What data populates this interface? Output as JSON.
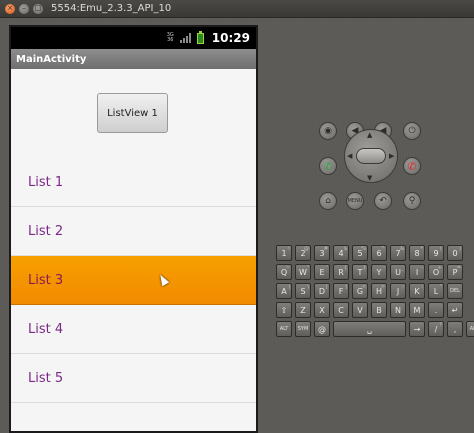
{
  "window": {
    "title": "5554:Emu_2.3.3_API_10"
  },
  "statusbar": {
    "net_top": "3G",
    "net_bottom": "36",
    "time": "10:29"
  },
  "app": {
    "title": "MainActivity",
    "button_label": "ListView 1",
    "list_items": [
      "List 1",
      "List 2",
      "List 3",
      "List 4",
      "List 5"
    ],
    "selected_index": 2
  },
  "controls": {
    "row1": [
      "camera-icon",
      "volume-down-icon",
      "volume-up-icon",
      "power-icon"
    ],
    "row2": [
      "call-icon",
      "dpad",
      "end-call-icon"
    ],
    "row3": [
      "home-icon",
      "MENU",
      "back-icon",
      "search-icon"
    ]
  },
  "keyboard": {
    "row1": [
      {
        "k": "1",
        "s": "!"
      },
      {
        "k": "2",
        "s": "@"
      },
      {
        "k": "3",
        "s": "#"
      },
      {
        "k": "4",
        "s": "$"
      },
      {
        "k": "5",
        "s": "%"
      },
      {
        "k": "6",
        "s": "^"
      },
      {
        "k": "7",
        "s": "&"
      },
      {
        "k": "8",
        "s": "*"
      },
      {
        "k": "9",
        "s": "("
      },
      {
        "k": "0",
        "s": ")"
      }
    ],
    "row2": [
      {
        "k": "Q",
        "s": "~"
      },
      {
        "k": "W",
        "s": "\""
      },
      {
        "k": "E",
        "s": "'"
      },
      {
        "k": "R",
        "s": "{"
      },
      {
        "k": "T",
        "s": "}"
      },
      {
        "k": "Y",
        "s": "-"
      },
      {
        "k": "U",
        "s": "_"
      },
      {
        "k": "I",
        "s": "-"
      },
      {
        "k": "O",
        "s": "+"
      },
      {
        "k": "P",
        "s": "="
      }
    ],
    "row3": [
      {
        "k": "A",
        "s": "|"
      },
      {
        "k": "S",
        "s": "\\"
      },
      {
        "k": "D",
        "s": "["
      },
      {
        "k": "F",
        "s": "]"
      },
      {
        "k": "G",
        "s": "<"
      },
      {
        "k": "H",
        "s": ">"
      },
      {
        "k": "J",
        "s": ";"
      },
      {
        "k": "K",
        "s": ":"
      },
      {
        "k": "L",
        "s": "\""
      },
      {
        "k": "DEL",
        "s": ""
      }
    ],
    "row4": [
      {
        "k": "⇧",
        "s": ""
      },
      {
        "k": "Z",
        "s": ""
      },
      {
        "k": "X",
        "s": ""
      },
      {
        "k": "C",
        "s": ""
      },
      {
        "k": "V",
        "s": ""
      },
      {
        "k": "B",
        "s": ""
      },
      {
        "k": "N",
        "s": ""
      },
      {
        "k": "M",
        "s": ""
      },
      {
        "k": ".",
        "s": ""
      },
      {
        "k": "↵",
        "s": ""
      }
    ],
    "row5": [
      {
        "k": "ALT",
        "s": ""
      },
      {
        "k": "SYM",
        "s": ""
      },
      {
        "k": "@",
        "s": ""
      },
      {
        "k": "␣",
        "s": ""
      },
      {
        "k": "→",
        "s": ""
      },
      {
        "k": "/",
        "s": "?"
      },
      {
        "k": ",",
        "s": ""
      },
      {
        "k": "ALT",
        "s": ""
      }
    ]
  }
}
